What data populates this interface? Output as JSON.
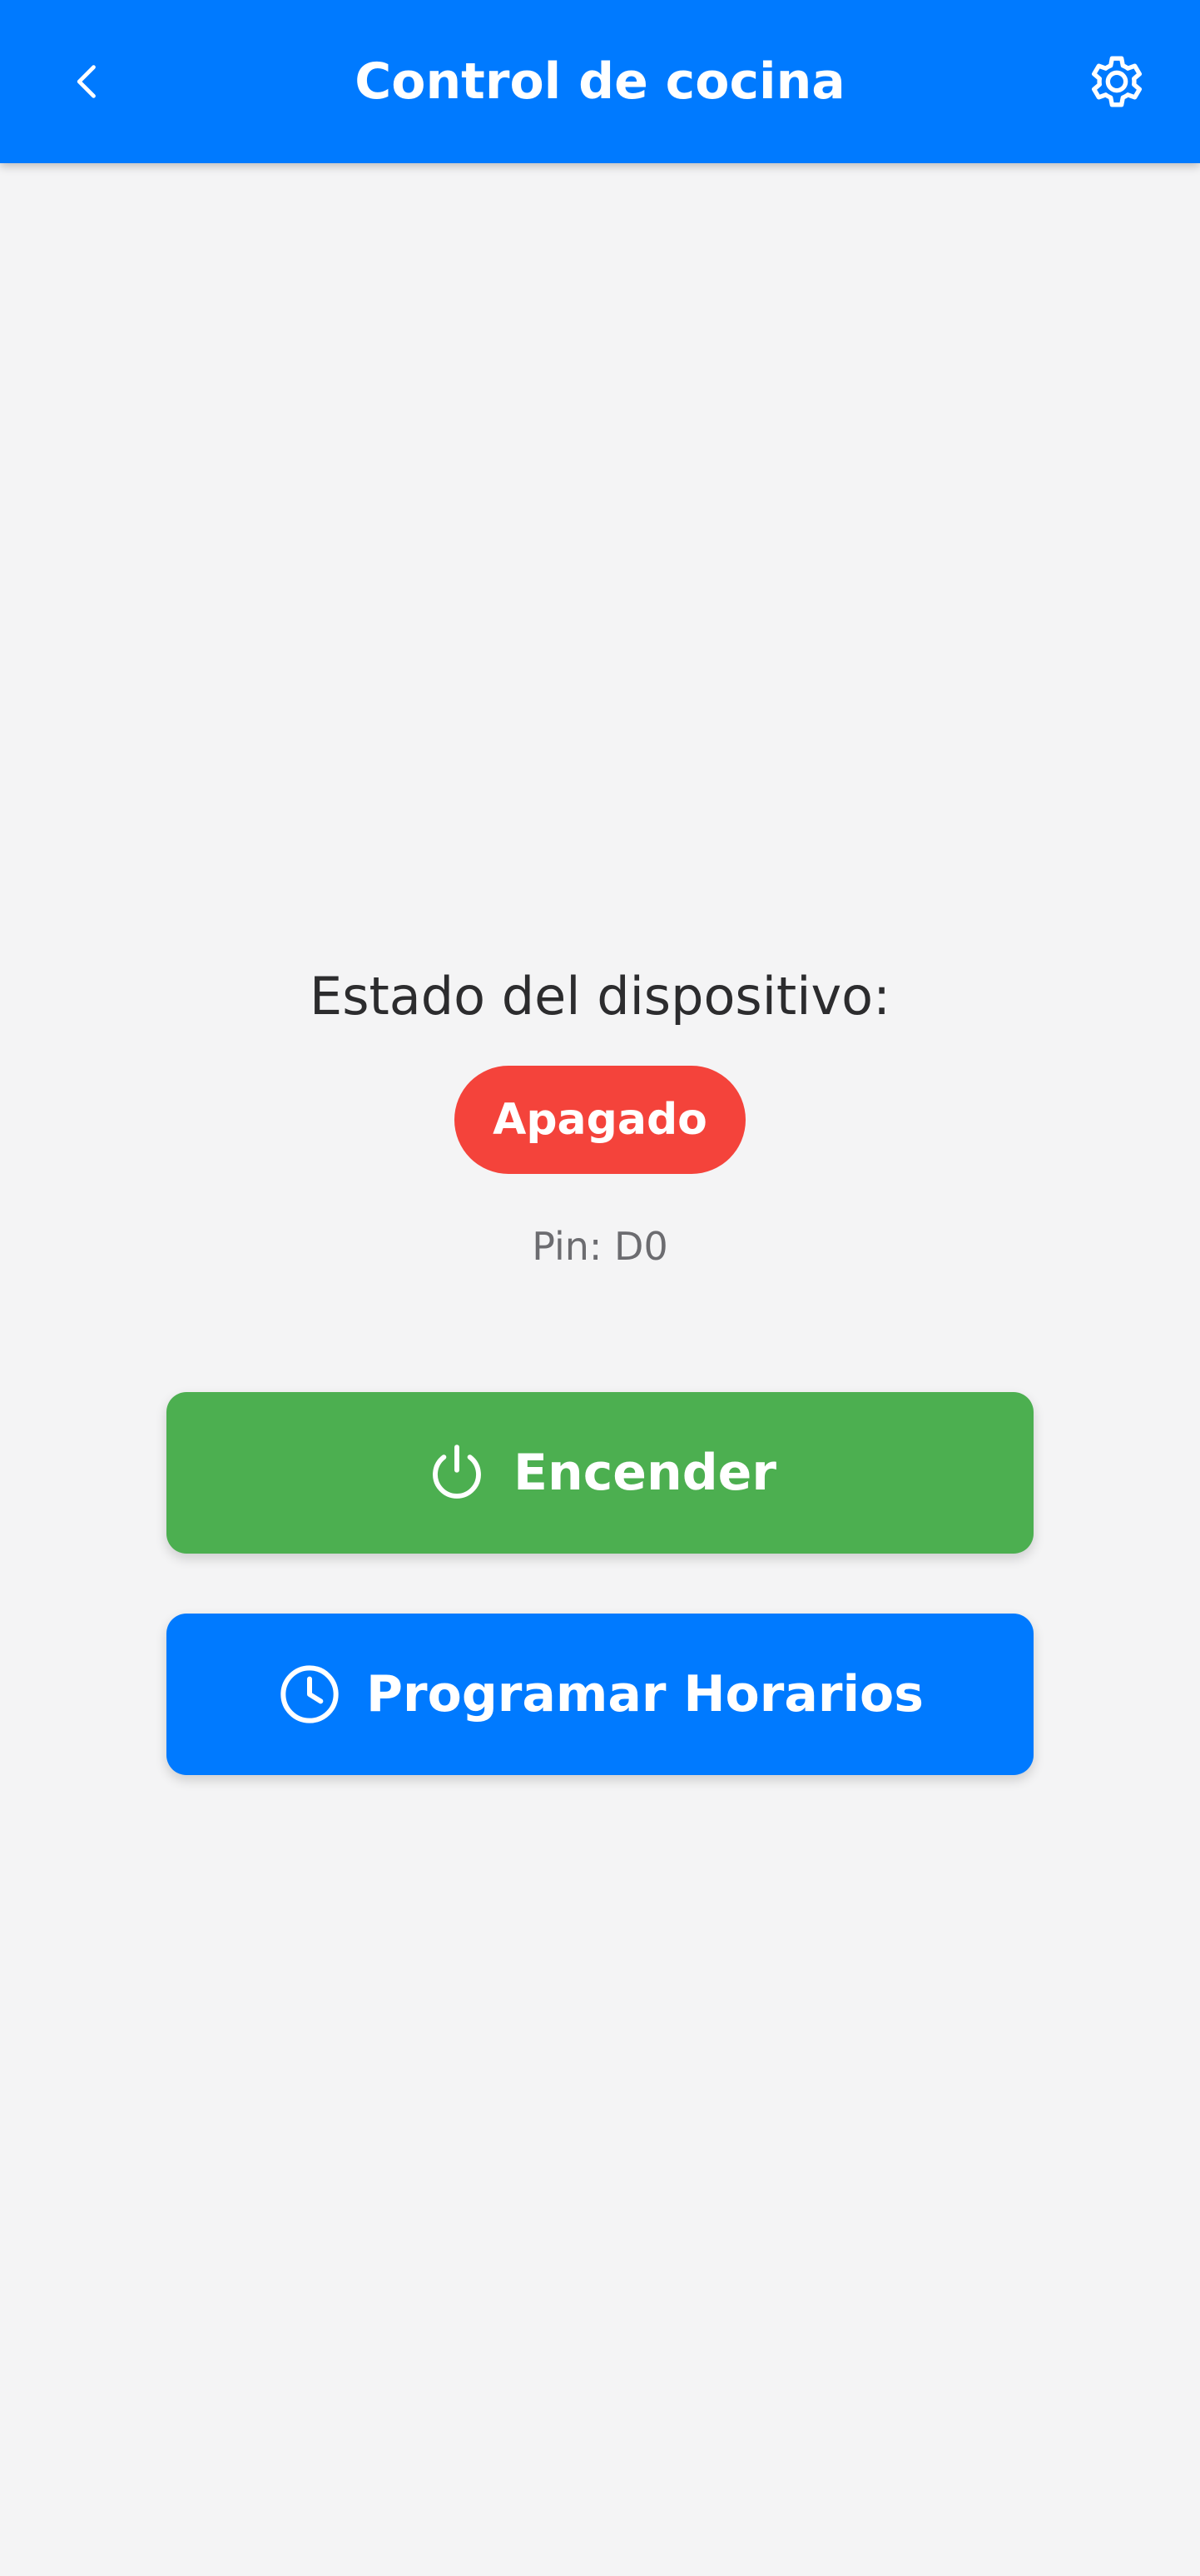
{
  "header": {
    "title": "Control de cocina",
    "back_icon": "chevron-left-icon",
    "settings_icon": "gear-icon"
  },
  "device": {
    "status_label": "Estado del dispositivo:",
    "status": "Apagado",
    "status_color": "#f4433b",
    "pin": "Pin: D0"
  },
  "actions": {
    "power_label": "Encender",
    "power_icon": "power-icon",
    "power_color": "#4caf50",
    "schedule_label": "Programar Horarios",
    "schedule_icon": "clock-icon",
    "schedule_color": "#007aff"
  },
  "theme": {
    "primary": "#007aff",
    "background": "#f4f4f5"
  }
}
